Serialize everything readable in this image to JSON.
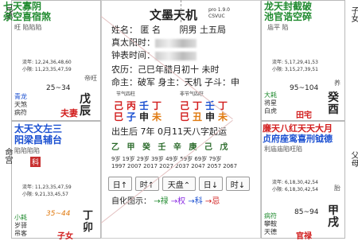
{
  "left_edge": {
    "top": "兄弟",
    "bottom": "命宫"
  },
  "right_edge": {
    "top": "子女",
    "bottom": "父母"
  },
  "left_col_labels": {
    "upper": "七杀",
    "lower": "丑"
  },
  "tl_palace": {
    "stars_r1": "七天寡阴",
    "stars_r2": "杀空喜宿煞",
    "brightness": "旺  陷陷陷",
    "flow": "流年: 12,24,36,48,60",
    "minor": "小限: 11,23,35,47,59",
    "age": "25~34",
    "ganzhi_top": "帝旺",
    "gong": "戊辰",
    "gods": [
      "青龙",
      "天煞",
      "病符"
    ],
    "gong_name": "夫妻"
  },
  "bl_palace": {
    "stars_r1": "太天文左三",
    "stars_r2": "阳梁昌辅台",
    "brightness": "陷陷陷陷",
    "badge": "科",
    "flow": "流年: 11,23,35,47,59",
    "minor": "小限: 9,21,33,45,57",
    "age": "35~44",
    "gods": [
      "小耗",
      "岁驿",
      "吊客"
    ],
    "gong": "丁卯",
    "gong_name": "子女"
  },
  "tr_palace": {
    "stars_r1": "龙天封截破",
    "stars_r2": "池官诰空碎",
    "brightness": "庙平   陷",
    "flow": "流年: 5,17,29,41,53",
    "minor": "小限: 3,15,27,39,51",
    "age": "95~104",
    "ganzhi_top": "养",
    "gong": "癸酉",
    "gods": [
      "大耗",
      "将星",
      "白虎"
    ],
    "gong_name": "田宅"
  },
  "br_palace": {
    "stars_r1": "廉天八红天天大月",
    "stars_r2": "贞府座鸾喜刑钺德",
    "brightness": "利庙庙陷旺陷",
    "flow": "流年: 6,18,30,42,54",
    "minor": "小限: 6,18,30,42,54",
    "age": "85~94",
    "gods": [
      "病符",
      "攀鞍",
      "天德"
    ],
    "gong": "甲戌",
    "ganzhi_top": "胎",
    "gong_name": "官禄"
  },
  "center": {
    "title": "文墨天机",
    "version": "pro 1.9.0",
    "version2": "CSVUC",
    "name_label": "姓名：",
    "name_value": "匿 名",
    "gender": "阴男 土五局",
    "true_sun_label": "真太阳时：",
    "clock_label": "钟表时间：",
    "lunar": "农历：己巳年腊月初十 未时",
    "master": "命主：破军 身主：天机 子斗：申",
    "pillar_head_left": "节气四柱",
    "pillar_head_right": "非节气四柱",
    "pillars_left": [
      "己",
      "丙",
      "壬",
      "丁"
    ],
    "pillars_left_b": [
      "巳",
      "子",
      "申",
      "未"
    ],
    "pillars_right": [
      "己",
      "丁",
      "壬",
      "丁"
    ],
    "pillars_right_b": [
      "巳",
      "丑",
      "申",
      "未"
    ],
    "qiyun": "出生后 7年 0月11天八字起运",
    "dayun_top": "乙 甲 癸 壬 辛 庚 己 戊",
    "dayun_age": "9岁 19岁 29岁 39岁 49岁 59岁 69岁 79岁",
    "dayun_year": "1997 2007 2017 2027 2037 2047 2057 2067",
    "btn_day_up": "日↑",
    "btn_hour_up": "时↑",
    "btn_tianpan": "天盘⌃",
    "btn_day_down": "日↓",
    "btn_hour_down": "时↓",
    "legend_label": "自化图示：",
    "legend": [
      "→禄",
      "→权",
      "→科",
      "→忌"
    ]
  },
  "colors": {
    "green": "#1f8a2e",
    "blue": "#1a4fd1",
    "red": "#d21e1e",
    "purple": "#8a2be2"
  }
}
